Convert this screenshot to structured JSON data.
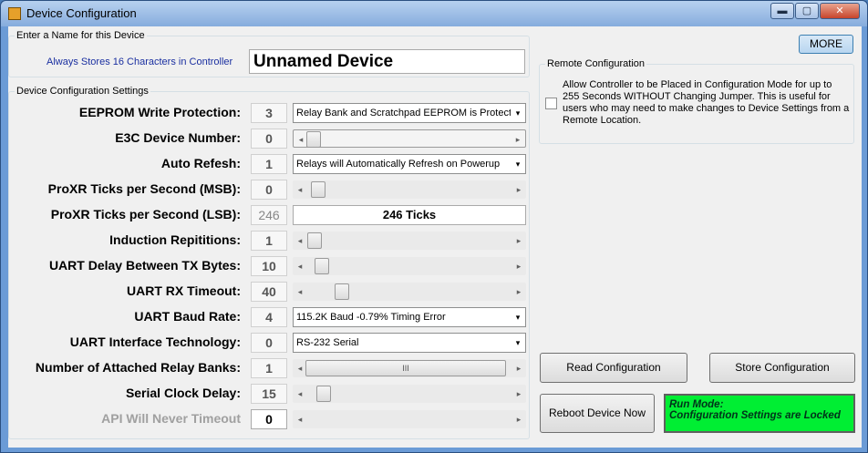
{
  "window": {
    "title": "Device Configuration",
    "min": "▬",
    "max": "▢",
    "close": "✕"
  },
  "name_group": {
    "title": "Enter a Name for this Device",
    "hint": "Always Stores 16 Characters in Controller",
    "value": "Unnamed Device"
  },
  "settings_group": {
    "title": "Device Configuration Settings",
    "rows": [
      {
        "label": "EEPROM Write Protection:",
        "value": "3",
        "control": "combo",
        "text": "Relay Bank and Scratchpad EEPROM is Protecte"
      },
      {
        "label": "E3C Device Number:",
        "value": "0",
        "control": "scroll",
        "thumb": 0.0
      },
      {
        "label": "Auto Refesh:",
        "value": "1",
        "control": "combo",
        "text": "Relays will Automatically Refresh on Powerup"
      },
      {
        "label": "ProXR Ticks per Second (MSB):",
        "value": "0",
        "control": "scroll",
        "thumb": 0.0
      },
      {
        "label": "ProXR Ticks per Second (LSB):",
        "value": "246",
        "control": "text",
        "text": "246 Ticks"
      },
      {
        "label": "Induction Repititions:",
        "value": "1",
        "control": "scroll",
        "thumb": 0.0
      },
      {
        "label": "UART Delay Between TX Bytes:",
        "value": "10",
        "control": "scroll",
        "thumb": 0.0
      },
      {
        "label": "UART RX Timeout:",
        "value": "40",
        "control": "scroll",
        "thumb": 0.0
      },
      {
        "label": "UART Baud Rate:",
        "value": "4",
        "control": "combo",
        "text": "115.2K Baud  -0.79% Timing Error"
      },
      {
        "label": "UART Interface Technology:",
        "value": "0",
        "control": "combo",
        "text": "RS-232 Serial"
      },
      {
        "label": "Number of Attached Relay Banks:",
        "value": "1",
        "control": "scroll",
        "thumb": 0.0,
        "thumb_text": "III"
      },
      {
        "label": "Serial Clock Delay:",
        "value": "15",
        "control": "scroll",
        "thumb": 0.0
      },
      {
        "label": "API Will Never Timeout",
        "value": "0",
        "control": "scroll",
        "thumb": 0.0
      }
    ]
  },
  "more_button": "MORE",
  "remote_group": {
    "title": "Remote Configuration",
    "checkbox_text": "Allow Controller to be Placed in Configuration Mode for up to 255 Seconds WITHOUT Changing Jumper.  This is useful for users who may need to make changes to Device Settings from a Remote Location.",
    "checked": false
  },
  "buttons": {
    "read": "Read Configuration",
    "store": "Store Configuration",
    "reboot": "Reboot Device Now"
  },
  "status": {
    "line1": "Run Mode:",
    "line2": "Configuration Settings are Locked",
    "color": "#00ee33"
  },
  "scroll_arrows": {
    "left": "◂",
    "right": "▸"
  },
  "combo_arrow": "▾"
}
